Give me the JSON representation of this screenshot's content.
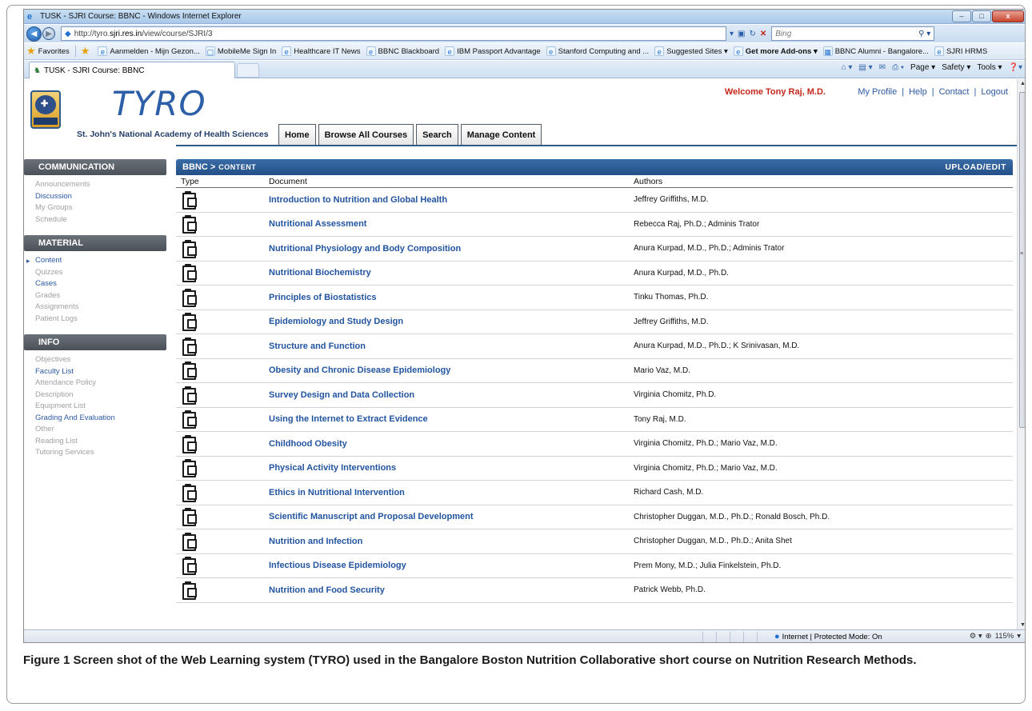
{
  "window": {
    "title": "TUSK - SJRI Course: BBNC - Windows Internet Explorer",
    "min_label": "–",
    "max_label": "□",
    "close_label": "x"
  },
  "addressbar": {
    "url_prefix": "http://tyro.",
    "url_domain": "sjri.res.in",
    "url_path": "/view/course/SJRI/3",
    "search_placeholder": "Bing"
  },
  "favorites": {
    "label": "Favorites",
    "items": [
      {
        "label": "Aanmelden - Mijn Gezon..."
      },
      {
        "label": "MobileMe Sign In"
      },
      {
        "label": "Healthcare IT News"
      },
      {
        "label": "BBNC Blackboard"
      },
      {
        "label": "IBM Passport Advantage"
      },
      {
        "label": "Stanford Computing and ..."
      },
      {
        "label": "Suggested Sites ▾"
      },
      {
        "label": "Get more Add-ons ▾"
      },
      {
        "label": "BBNC Alumni - Bangalore..."
      },
      {
        "label": "SJRI HRMS"
      }
    ]
  },
  "tab": {
    "label": "TUSK - SJRI Course: BBNC"
  },
  "commandbar": {
    "page": "Page ▾",
    "safety": "Safety ▾",
    "tools": "Tools ▾"
  },
  "site": {
    "brand": "TYRO",
    "institution": "St. John's National Academy of Health Sciences",
    "welcome": "Welcome Tony Raj, M.D.",
    "links": [
      "My Profile",
      "Help",
      "Contact",
      "Logout"
    ],
    "nav_tabs": [
      "Home",
      "Browse All Courses",
      "Search",
      "Manage Content"
    ]
  },
  "sidebar": {
    "sections": [
      {
        "title": "COMMUNICATION",
        "items": [
          {
            "label": "Announcements",
            "active": false
          },
          {
            "label": "Discussion",
            "active": true
          },
          {
            "label": "My Groups",
            "active": false
          },
          {
            "label": "Schedule",
            "active": false
          }
        ]
      },
      {
        "title": "MATERIAL",
        "items": [
          {
            "label": "Content",
            "active": true,
            "current": true
          },
          {
            "label": "Quizzes",
            "active": false
          },
          {
            "label": "Cases",
            "active": true
          },
          {
            "label": "Grades",
            "active": false
          },
          {
            "label": "Assignments",
            "active": false
          },
          {
            "label": "Patient Logs",
            "active": false
          }
        ]
      },
      {
        "title": "INFO",
        "items": [
          {
            "label": "Objectives",
            "active": false
          },
          {
            "label": "Faculty List",
            "active": true
          },
          {
            "label": "Attendance Policy",
            "active": false
          },
          {
            "label": "Description",
            "active": false
          },
          {
            "label": "Equipment List",
            "active": false
          },
          {
            "label": "Grading And Evaluation",
            "active": true
          },
          {
            "label": "Other",
            "active": false
          },
          {
            "label": "Reading List",
            "active": false
          },
          {
            "label": "Tutoring Services",
            "active": false
          }
        ]
      }
    ]
  },
  "content": {
    "crumb1": "BBNC >",
    "crumb2": "CONTENT",
    "action": "UPLOAD/EDIT",
    "headers": {
      "type": "Type",
      "document": "Document",
      "authors": "Authors"
    },
    "rows": [
      {
        "doc": "Introduction to Nutrition and Global Health",
        "authors": "Jeffrey Griffiths, M.D."
      },
      {
        "doc": "Nutritional Assessment",
        "authors": "Rebecca Raj, Ph.D.; Adminis Trator"
      },
      {
        "doc": "Nutritional Physiology and Body Composition",
        "authors": "Anura Kurpad, M.D., Ph.D.; Adminis Trator"
      },
      {
        "doc": "Nutritional Biochemistry",
        "authors": "Anura Kurpad, M.D., Ph.D."
      },
      {
        "doc": "Principles of Biostatistics",
        "authors": "Tinku Thomas, Ph.D."
      },
      {
        "doc": "Epidemiology and Study Design",
        "authors": "Jeffrey Griffiths, M.D."
      },
      {
        "doc": "Structure and Function",
        "authors": "Anura Kurpad, M.D., Ph.D.; K Srinivasan, M.D."
      },
      {
        "doc": "Obesity and Chronic Disease Epidemiology",
        "authors": "Mario Vaz, M.D."
      },
      {
        "doc": "Survey Design and Data Collection",
        "authors": "Virginia Chomitz, Ph.D."
      },
      {
        "doc": "Using the Internet to Extract Evidence",
        "authors": "Tony Raj, M.D."
      },
      {
        "doc": "Childhood Obesity",
        "authors": "Virginia Chomitz, Ph.D.; Mario Vaz, M.D."
      },
      {
        "doc": "Physical Activity Interventions",
        "authors": "Virginia Chomitz, Ph.D.; Mario Vaz, M.D."
      },
      {
        "doc": "Ethics in Nutritional Intervention",
        "authors": "Richard Cash, M.D."
      },
      {
        "doc": "Scientific Manuscript and Proposal Development",
        "authors": "Christopher Duggan, M.D., Ph.D.; Ronald Bosch, Ph.D."
      },
      {
        "doc": "Nutrition and Infection",
        "authors": "Christopher Duggan, M.D., Ph.D.; Anita Shet"
      },
      {
        "doc": "Infectious Disease Epidemiology",
        "authors": "Prem Mony, M.D.; Julia Finkelstein, Ph.D."
      },
      {
        "doc": "Nutrition and Food Security",
        "authors": "Patrick Webb, Ph.D."
      }
    ]
  },
  "statusbar": {
    "zone": "Internet | Protected Mode: On",
    "zoom": "115%"
  },
  "caption": {
    "label": "Figure 1",
    "text": "Screen shot of the Web Learning system (TYRO) used in the Bangalore Boston Nutrition Collaborative short course on Nutrition Research Methods."
  },
  "colors": {
    "brand_blue": "#2d5ea8",
    "welcome_red": "#c4261b",
    "link_blue": "#2254a0"
  }
}
